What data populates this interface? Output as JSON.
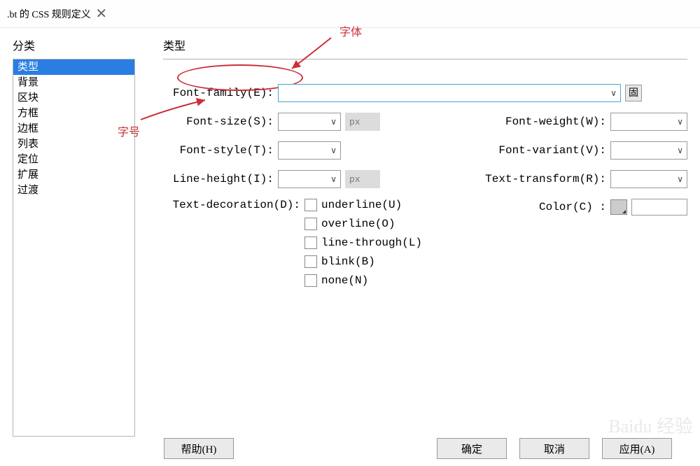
{
  "title": ".bt 的 CSS 规则定义",
  "close_glyph": "✕",
  "sidebar": {
    "title": "分类",
    "items": [
      "类型",
      "背景",
      "区块",
      "方框",
      "边框",
      "列表",
      "定位",
      "扩展",
      "过渡"
    ]
  },
  "main": {
    "title": "类型",
    "labels": {
      "font_family": "Font-family(E):",
      "font_size": "Font-size(S):",
      "font_weight": "Font-weight(W):",
      "font_style": "Font-style(T):",
      "font_variant": "Font-variant(V):",
      "line_height": "Line-height(I):",
      "text_transform": "Text-transform(R):",
      "text_decoration": "Text-decoration(D):",
      "color": "Color(C) :"
    },
    "unit_px": "px",
    "box_glyph": "固",
    "decorations": {
      "underline": "underline(U)",
      "overline": "overline(O)",
      "line_through": "line-through(L)",
      "blink": "blink(B)",
      "none": "none(N)"
    }
  },
  "buttons": {
    "help": "帮助(H)",
    "ok": "确定",
    "cancel": "取消",
    "apply": "应用(A)"
  },
  "annotations": {
    "font_label": "字体",
    "size_label": "字号"
  },
  "chevron": "∨"
}
